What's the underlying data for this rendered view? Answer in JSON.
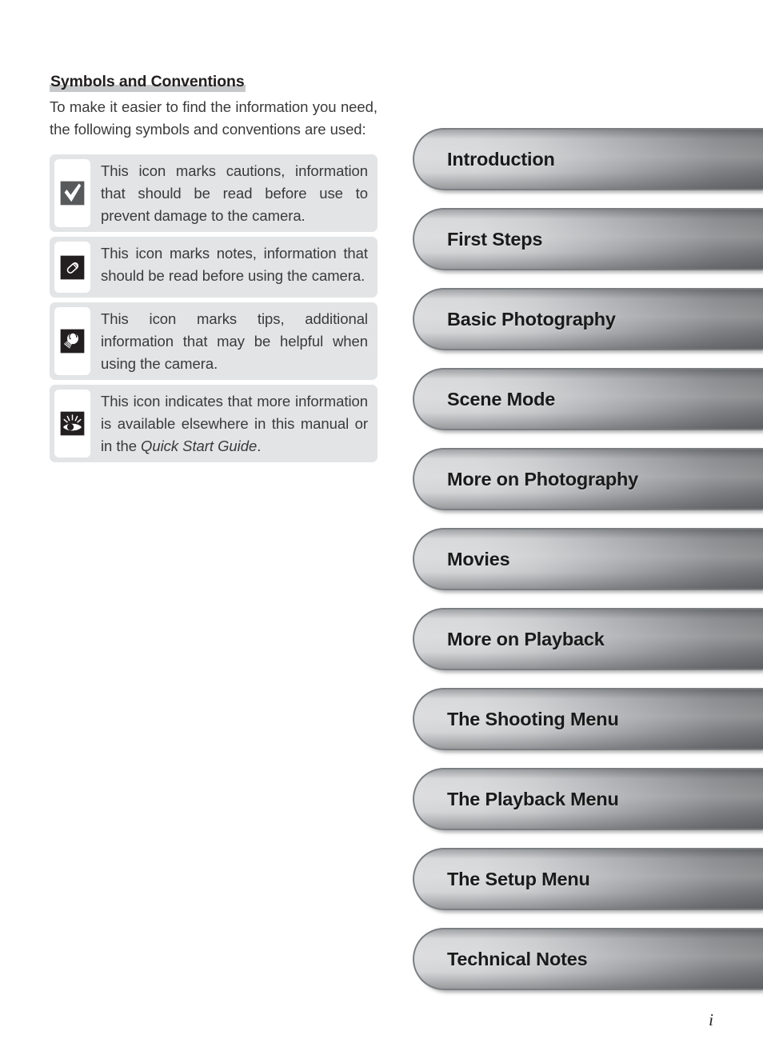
{
  "left": {
    "heading": "Symbols and Conventions",
    "intro": "To make it easier to find the information you need, the following symbols and conventions are used:",
    "notes": [
      {
        "icon": "check-mark-icon",
        "text_before": "This icon marks cautions, information that should be read before use to prevent damage to the camera.",
        "text_italic": "",
        "text_after": ""
      },
      {
        "icon": "pencil-icon",
        "text_before": "This icon marks notes, information that should be read before using the camera.",
        "text_italic": "",
        "text_after": ""
      },
      {
        "icon": "lightbulb-icon",
        "text_before": "This icon marks tips, additional information that may be helpful when using the camera.",
        "text_italic": "",
        "text_after": ""
      },
      {
        "icon": "eye-icon",
        "text_before": "This icon indicates that more information is available elsewhere in this manual or in the ",
        "text_italic": "Quick Start Guide",
        "text_after": "."
      }
    ]
  },
  "tabs": [
    {
      "label": "Introduction"
    },
    {
      "label": "First Steps"
    },
    {
      "label": "Basic Photography"
    },
    {
      "label": "Scene Mode"
    },
    {
      "label": "More on Photography"
    },
    {
      "label": "Movies"
    },
    {
      "label": "More on Playback"
    },
    {
      "label": "The Shooting Menu"
    },
    {
      "label": "The Playback Menu"
    },
    {
      "label": "The Setup Menu"
    },
    {
      "label": "Technical Notes"
    }
  ],
  "page_number": "i",
  "colors": {
    "note_box_bg": "#e3e4e5",
    "note_icon_panel_bg": "#ffffff",
    "icon_tile_check": "#58595b",
    "icon_tile_dark": "#231f20",
    "heading_highlight": "#c7c8ca",
    "tab_border": "#7b7f82",
    "tab_gradient_start": "#d2d3d5",
    "tab_gradient_end": "#6b6e70",
    "text": "#3a3a3c"
  }
}
